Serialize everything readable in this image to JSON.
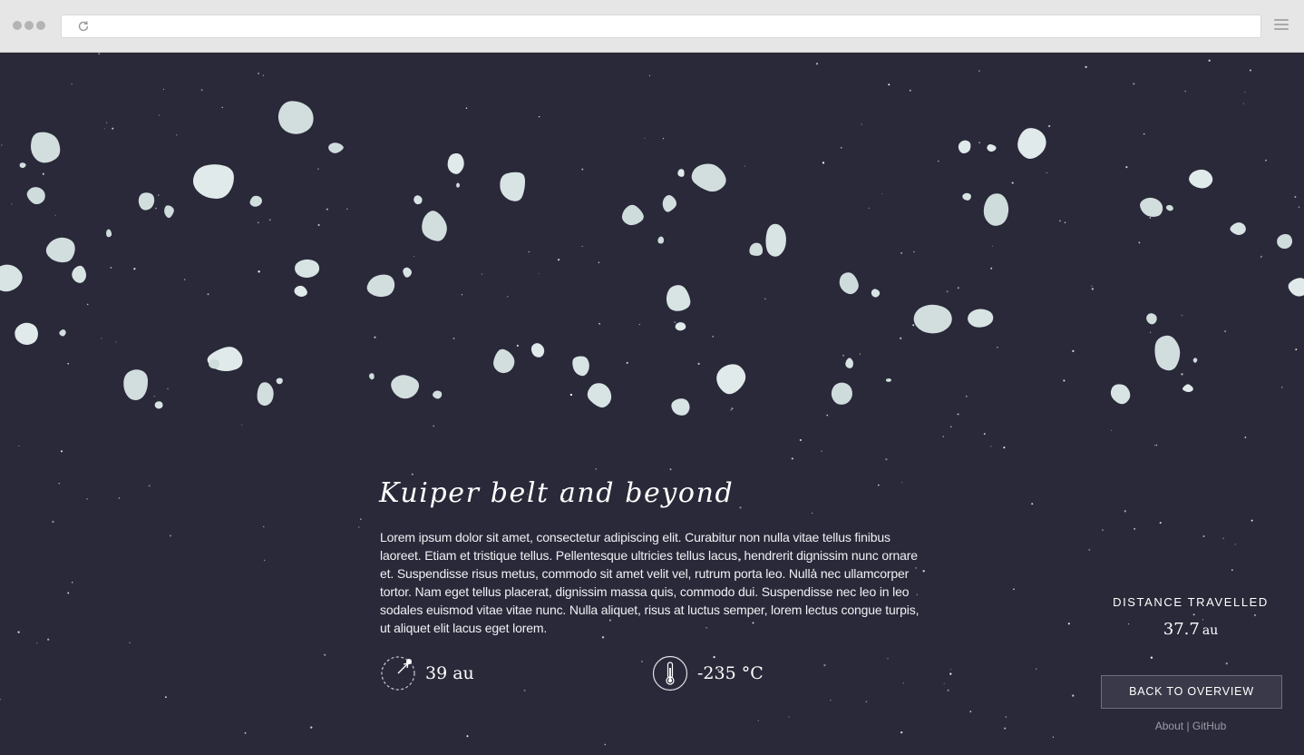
{
  "browser": {
    "reload_icon": "reload-icon",
    "menu_icon": "hamburger-menu-icon"
  },
  "section": {
    "title": "Kuiper belt and beyond",
    "description": "Lorem ipsum dolor sit amet, consectetur adipiscing elit. Curabitur non nulla vitae tellus finibus laoreet. Etiam et tristique tellus. Pellentesque ultricies tellus lacus, hendrerit dignissim nunc ornare et. Suspendisse risus metus, commodo sit amet velit vel, rutrum porta leo. Nulla nec ullamcorper tortor. Nam eget tellus placerat, dignissim massa quis, commodo dui. Suspendisse nec leo in leo sodales euismod vitae vitae nunc. Nulla aliquet, risus at luctus semper, lorem lectus congue turpis, ut aliquet elit lacus eget lorem.",
    "stats": {
      "distance": {
        "value": "39 au",
        "icon": "orbit-distance-icon"
      },
      "temperature": {
        "value": "-235 °C",
        "icon": "thermometer-icon"
      }
    }
  },
  "travel": {
    "label": "DISTANCE TRAVELLED",
    "value": "37.7",
    "unit": "au"
  },
  "buttons": {
    "back": "BACK TO OVERVIEW"
  },
  "footer": {
    "about": "About",
    "separator": "|",
    "github": "GitHub"
  },
  "colors": {
    "background": "#292939",
    "asteroid": "#d6e3e3",
    "text": "#ffffff",
    "muted": "#9b9ba8"
  }
}
